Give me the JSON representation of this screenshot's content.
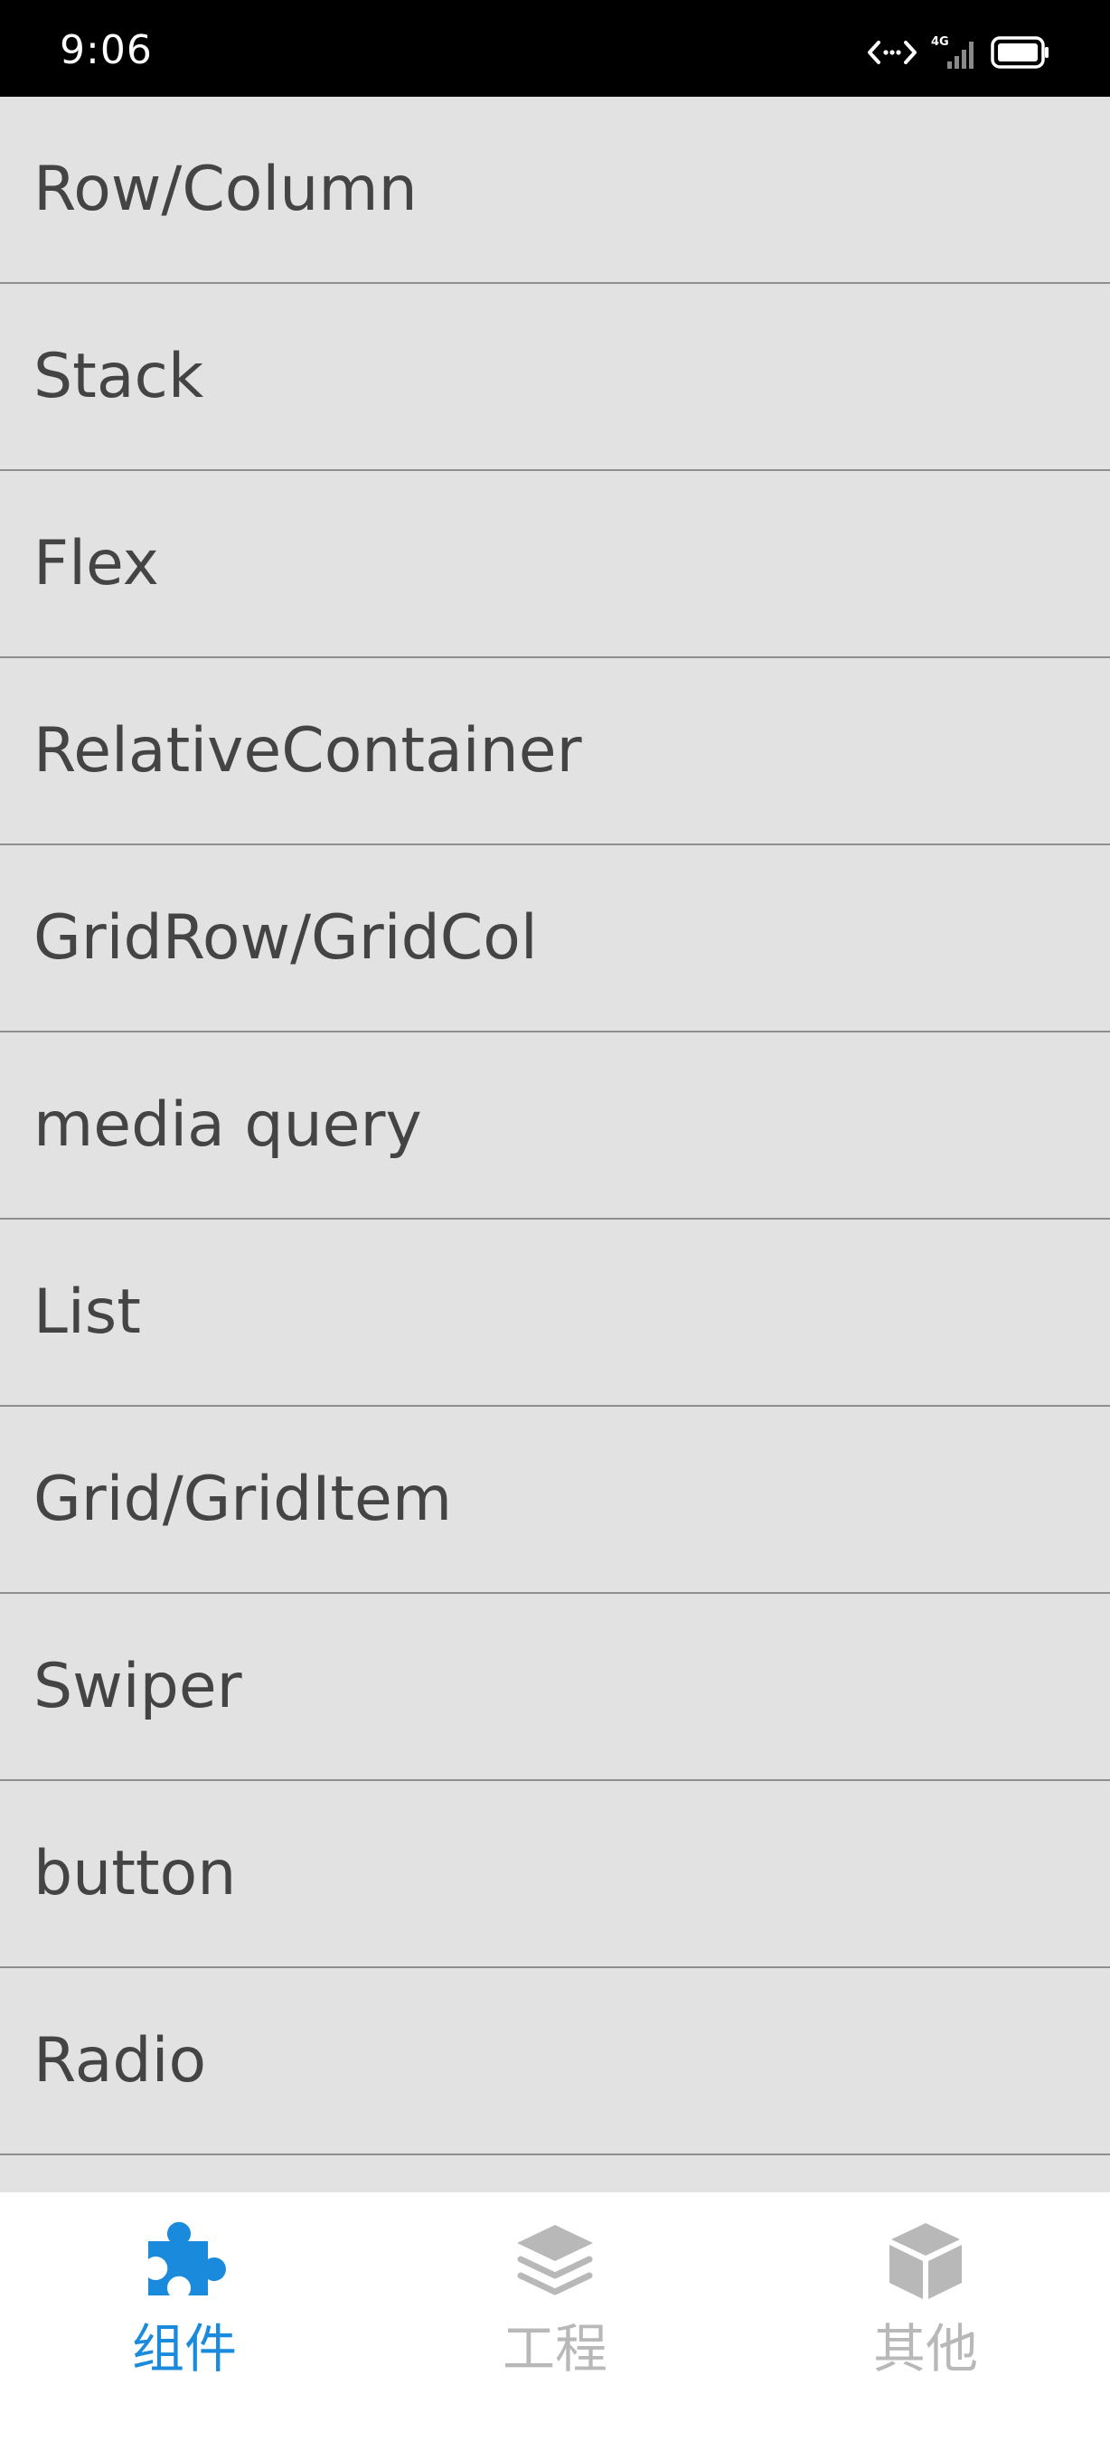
{
  "status_bar": {
    "time": "9:06",
    "network_label": "4G",
    "icons": [
      "data-transfer-icon",
      "signal-icon",
      "battery-icon"
    ]
  },
  "list": {
    "items": [
      {
        "label": "Row/Column"
      },
      {
        "label": "Stack"
      },
      {
        "label": "Flex"
      },
      {
        "label": "RelativeContainer"
      },
      {
        "label": "GridRow/GridCol"
      },
      {
        "label": "media query"
      },
      {
        "label": "List"
      },
      {
        "label": "Grid/GridItem"
      },
      {
        "label": "Swiper"
      },
      {
        "label": "button"
      },
      {
        "label": "Radio"
      },
      {
        "label": ""
      }
    ]
  },
  "tabbar": {
    "active_color": "#1a8bdc",
    "inactive_color": "#b8b8b8",
    "tabs": [
      {
        "label": "组件",
        "icon": "puzzle-icon",
        "active": true
      },
      {
        "label": "工程",
        "icon": "layers-icon",
        "active": false
      },
      {
        "label": "其他",
        "icon": "cube-icon",
        "active": false
      }
    ]
  }
}
